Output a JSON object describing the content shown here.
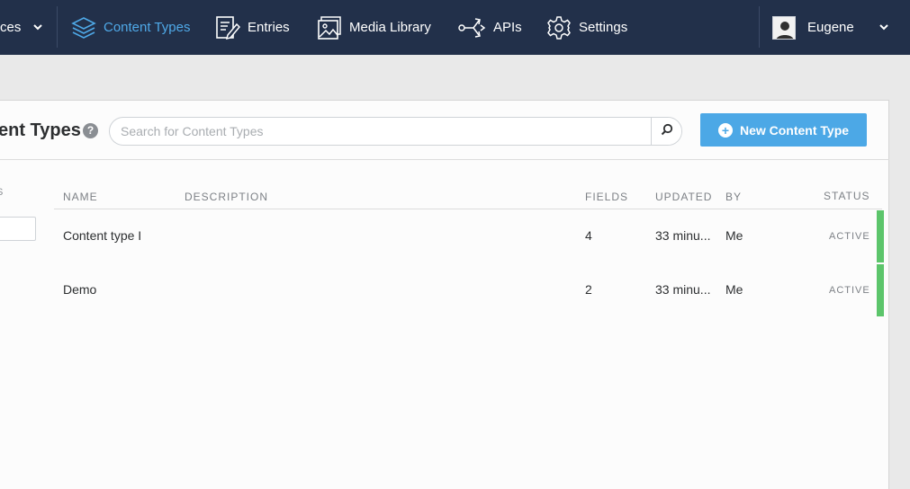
{
  "topbar": {
    "space_label": "ces",
    "nav": [
      {
        "label": "Content Types",
        "icon": "layers-icon",
        "active": true
      },
      {
        "label": "Entries",
        "icon": "entries-icon"
      },
      {
        "label": "Media Library",
        "icon": "image-icon"
      },
      {
        "label": "APIs",
        "icon": "share-icon"
      },
      {
        "label": "Settings",
        "icon": "gear-icon"
      }
    ],
    "user_name": "Eugene"
  },
  "header": {
    "title": "ent Types",
    "search_placeholder": "Search for Content Types",
    "search_value": "",
    "new_button_label": "New Content Type"
  },
  "sidebar": {
    "filter_label": "S"
  },
  "table": {
    "columns": {
      "name": "NAME",
      "description": "DESCRIPTION",
      "fields": "FIELDS",
      "updated": "UPDATED",
      "by": "BY",
      "status": "STATUS"
    },
    "rows": [
      {
        "name": "Content type I",
        "description": "",
        "fields": "4",
        "updated": "33 minu...",
        "by": "Me",
        "status": "ACTIVE"
      },
      {
        "name": "Demo",
        "description": "",
        "fields": "2",
        "updated": "33 minu...",
        "by": "Me",
        "status": "ACTIVE"
      }
    ]
  },
  "colors": {
    "topbar_bg": "#22304a",
    "accent": "#4fa9e8",
    "button_bg": "#4ca8e6",
    "status_active": "#5cc56b"
  }
}
